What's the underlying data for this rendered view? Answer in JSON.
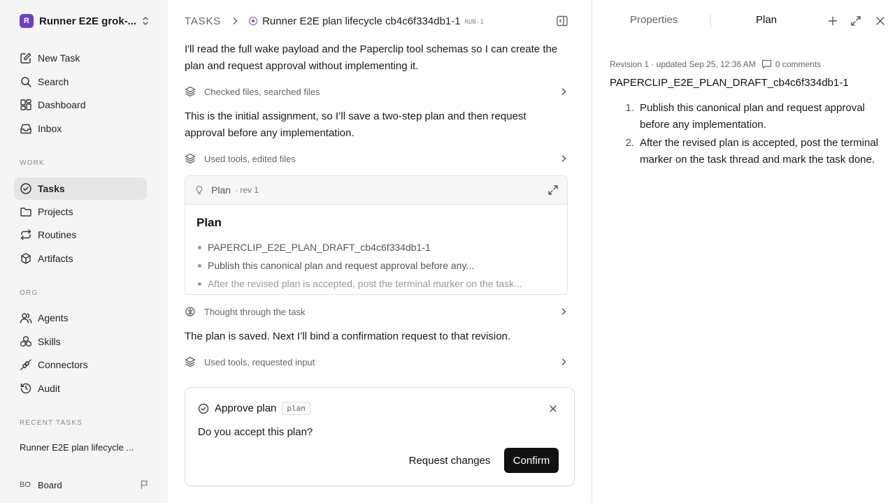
{
  "workspace": {
    "initial": "R",
    "name": "Runner E2E grok-..."
  },
  "nav_primary": [
    {
      "label": "New Task",
      "icon": "edit-icon"
    },
    {
      "label": "Search",
      "icon": "search-icon"
    },
    {
      "label": "Dashboard",
      "icon": "dashboard-icon"
    },
    {
      "label": "Inbox",
      "icon": "inbox-icon"
    }
  ],
  "sections": {
    "work": "WORK",
    "org": "ORG",
    "recent": "RECENT TASKS"
  },
  "nav_work": [
    {
      "label": "Tasks",
      "icon": "check-circle-icon",
      "active": true
    },
    {
      "label": "Projects",
      "icon": "folder-icon"
    },
    {
      "label": "Routines",
      "icon": "repeat-icon"
    },
    {
      "label": "Artifacts",
      "icon": "box-icon"
    }
  ],
  "nav_org": [
    {
      "label": "Agents",
      "icon": "users-icon"
    },
    {
      "label": "Skills",
      "icon": "boxes-icon"
    },
    {
      "label": "Connectors",
      "icon": "plug-icon"
    },
    {
      "label": "Audit",
      "icon": "history-icon"
    }
  ],
  "recent_task": "Runner E2E plan lifecycle ...",
  "board": {
    "initials": "BO",
    "name": "Board"
  },
  "breadcrumb": {
    "root": "TASKS",
    "title": "Runner E2E plan lifecycle cb4c6f334db1-1",
    "id": "RUN-1"
  },
  "thread": {
    "msg1": "I'll read the full wake payload and the Paperclip tool schemas so I can create the plan and request approval without implementing it.",
    "tool1": "Checked files, searched files",
    "msg2": "This is the initial assignment, so I’ll save a two-step plan and then request approval before any implementation.",
    "tool2": "Used tools, edited files",
    "plan_card": {
      "label": "Plan",
      "rev": "· rev 1",
      "heading": "Plan",
      "items": [
        "PAPERCLIP_E2E_PLAN_DRAFT_cb4c6f334db1-1",
        "Publish this canonical plan and request approval before any...",
        "After the revised plan is accepted, post the terminal marker on the task..."
      ]
    },
    "thought": "Thought through the task",
    "msg3": "The plan is saved. Next I’ll bind a confirmation request to that revision.",
    "tool3": "Used tools, requested input"
  },
  "approval": {
    "title": "Approve plan",
    "tag": "plan",
    "question": "Do you accept this plan?",
    "request_changes": "Request changes",
    "confirm": "Confirm"
  },
  "right_panel": {
    "tabs": [
      "Properties",
      "Plan"
    ],
    "active_tab": "Plan",
    "meta": "Revision 1 · updated Sep 25, 12:36 AM",
    "comments": "0 comments",
    "plan_name": "PAPERCLIP_E2E_PLAN_DRAFT_cb4c6f334db1-1",
    "steps": [
      {
        "num": "1.",
        "text": "Publish this canonical plan and request approval before any implementation."
      },
      {
        "num": "2.",
        "text": "After the revised plan is accepted, post the terminal marker on the task thread and mark the task done."
      }
    ]
  },
  "colors": {
    "accent": "#6d3fc4",
    "status": "#8b45c9",
    "confirm_bg": "#111111"
  }
}
